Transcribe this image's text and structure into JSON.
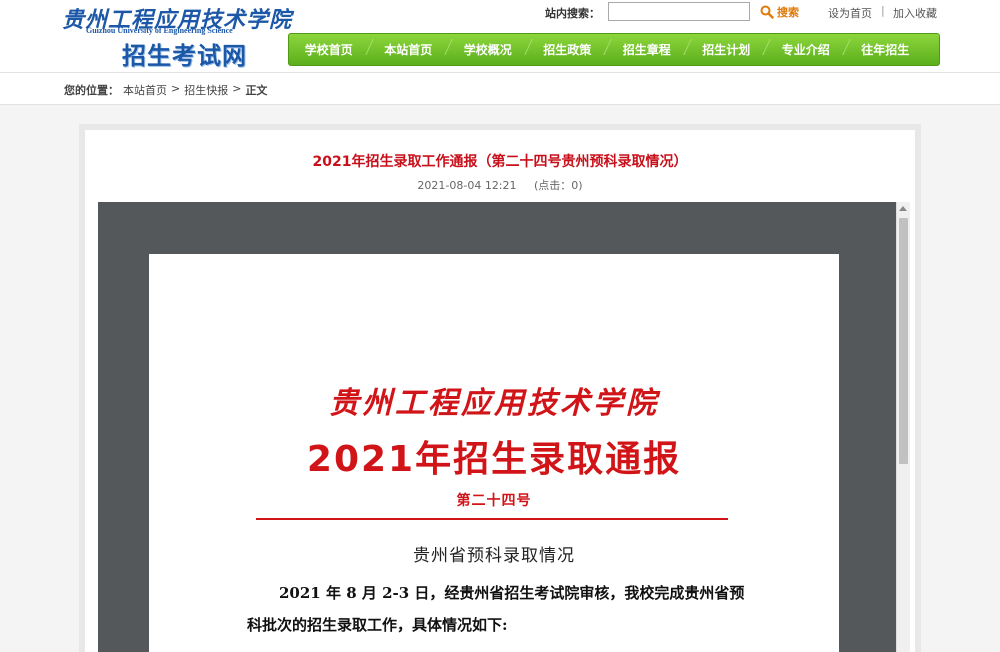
{
  "site": {
    "logo_school_cn": "贵州工程应用技术学院",
    "logo_school_en": "Guizhou University of Engineering Science",
    "logo_title": "招生考试网"
  },
  "search": {
    "label": "站内搜索：",
    "value": "",
    "placeholder": "",
    "button_label": "搜索"
  },
  "top_links": {
    "set_home": "设为首页",
    "separator": "|",
    "bookmark": "加入收藏"
  },
  "nav": {
    "items": [
      {
        "label": "学校首页"
      },
      {
        "label": "本站首页"
      },
      {
        "label": "学校概况"
      },
      {
        "label": "招生政策"
      },
      {
        "label": "招生章程"
      },
      {
        "label": "招生计划"
      },
      {
        "label": "专业介绍"
      },
      {
        "label": "往年招生"
      }
    ]
  },
  "breadcrumb": {
    "prefix": "您的位置：",
    "items": [
      {
        "label": "本站首页"
      },
      {
        "label": "招生快报"
      },
      {
        "label": "正文"
      }
    ],
    "separator": ">"
  },
  "article": {
    "title": "2021年招生录取工作通报（第二十四号贵州预科录取情况）",
    "date": "2021-08-04 12:21",
    "clicks": "(点击：0)"
  },
  "document": {
    "school_name": "贵州工程应用技术学院",
    "headline": "2021年招生录取通报",
    "issue": "第二十四号",
    "subtitle": "贵州省预科录取情况",
    "paragraph": "2021 年 8 月 2-3 日，经贵州省招生考试院审核，我校完成贵州省预科批次的招生录取工作，具体情况如下:"
  },
  "colors": {
    "brand_blue": "#1d58a8",
    "nav_green": "#5cae1c",
    "title_red": "#c8101b",
    "doc_red": "#d11418",
    "search_orange": "#e07a0a"
  }
}
